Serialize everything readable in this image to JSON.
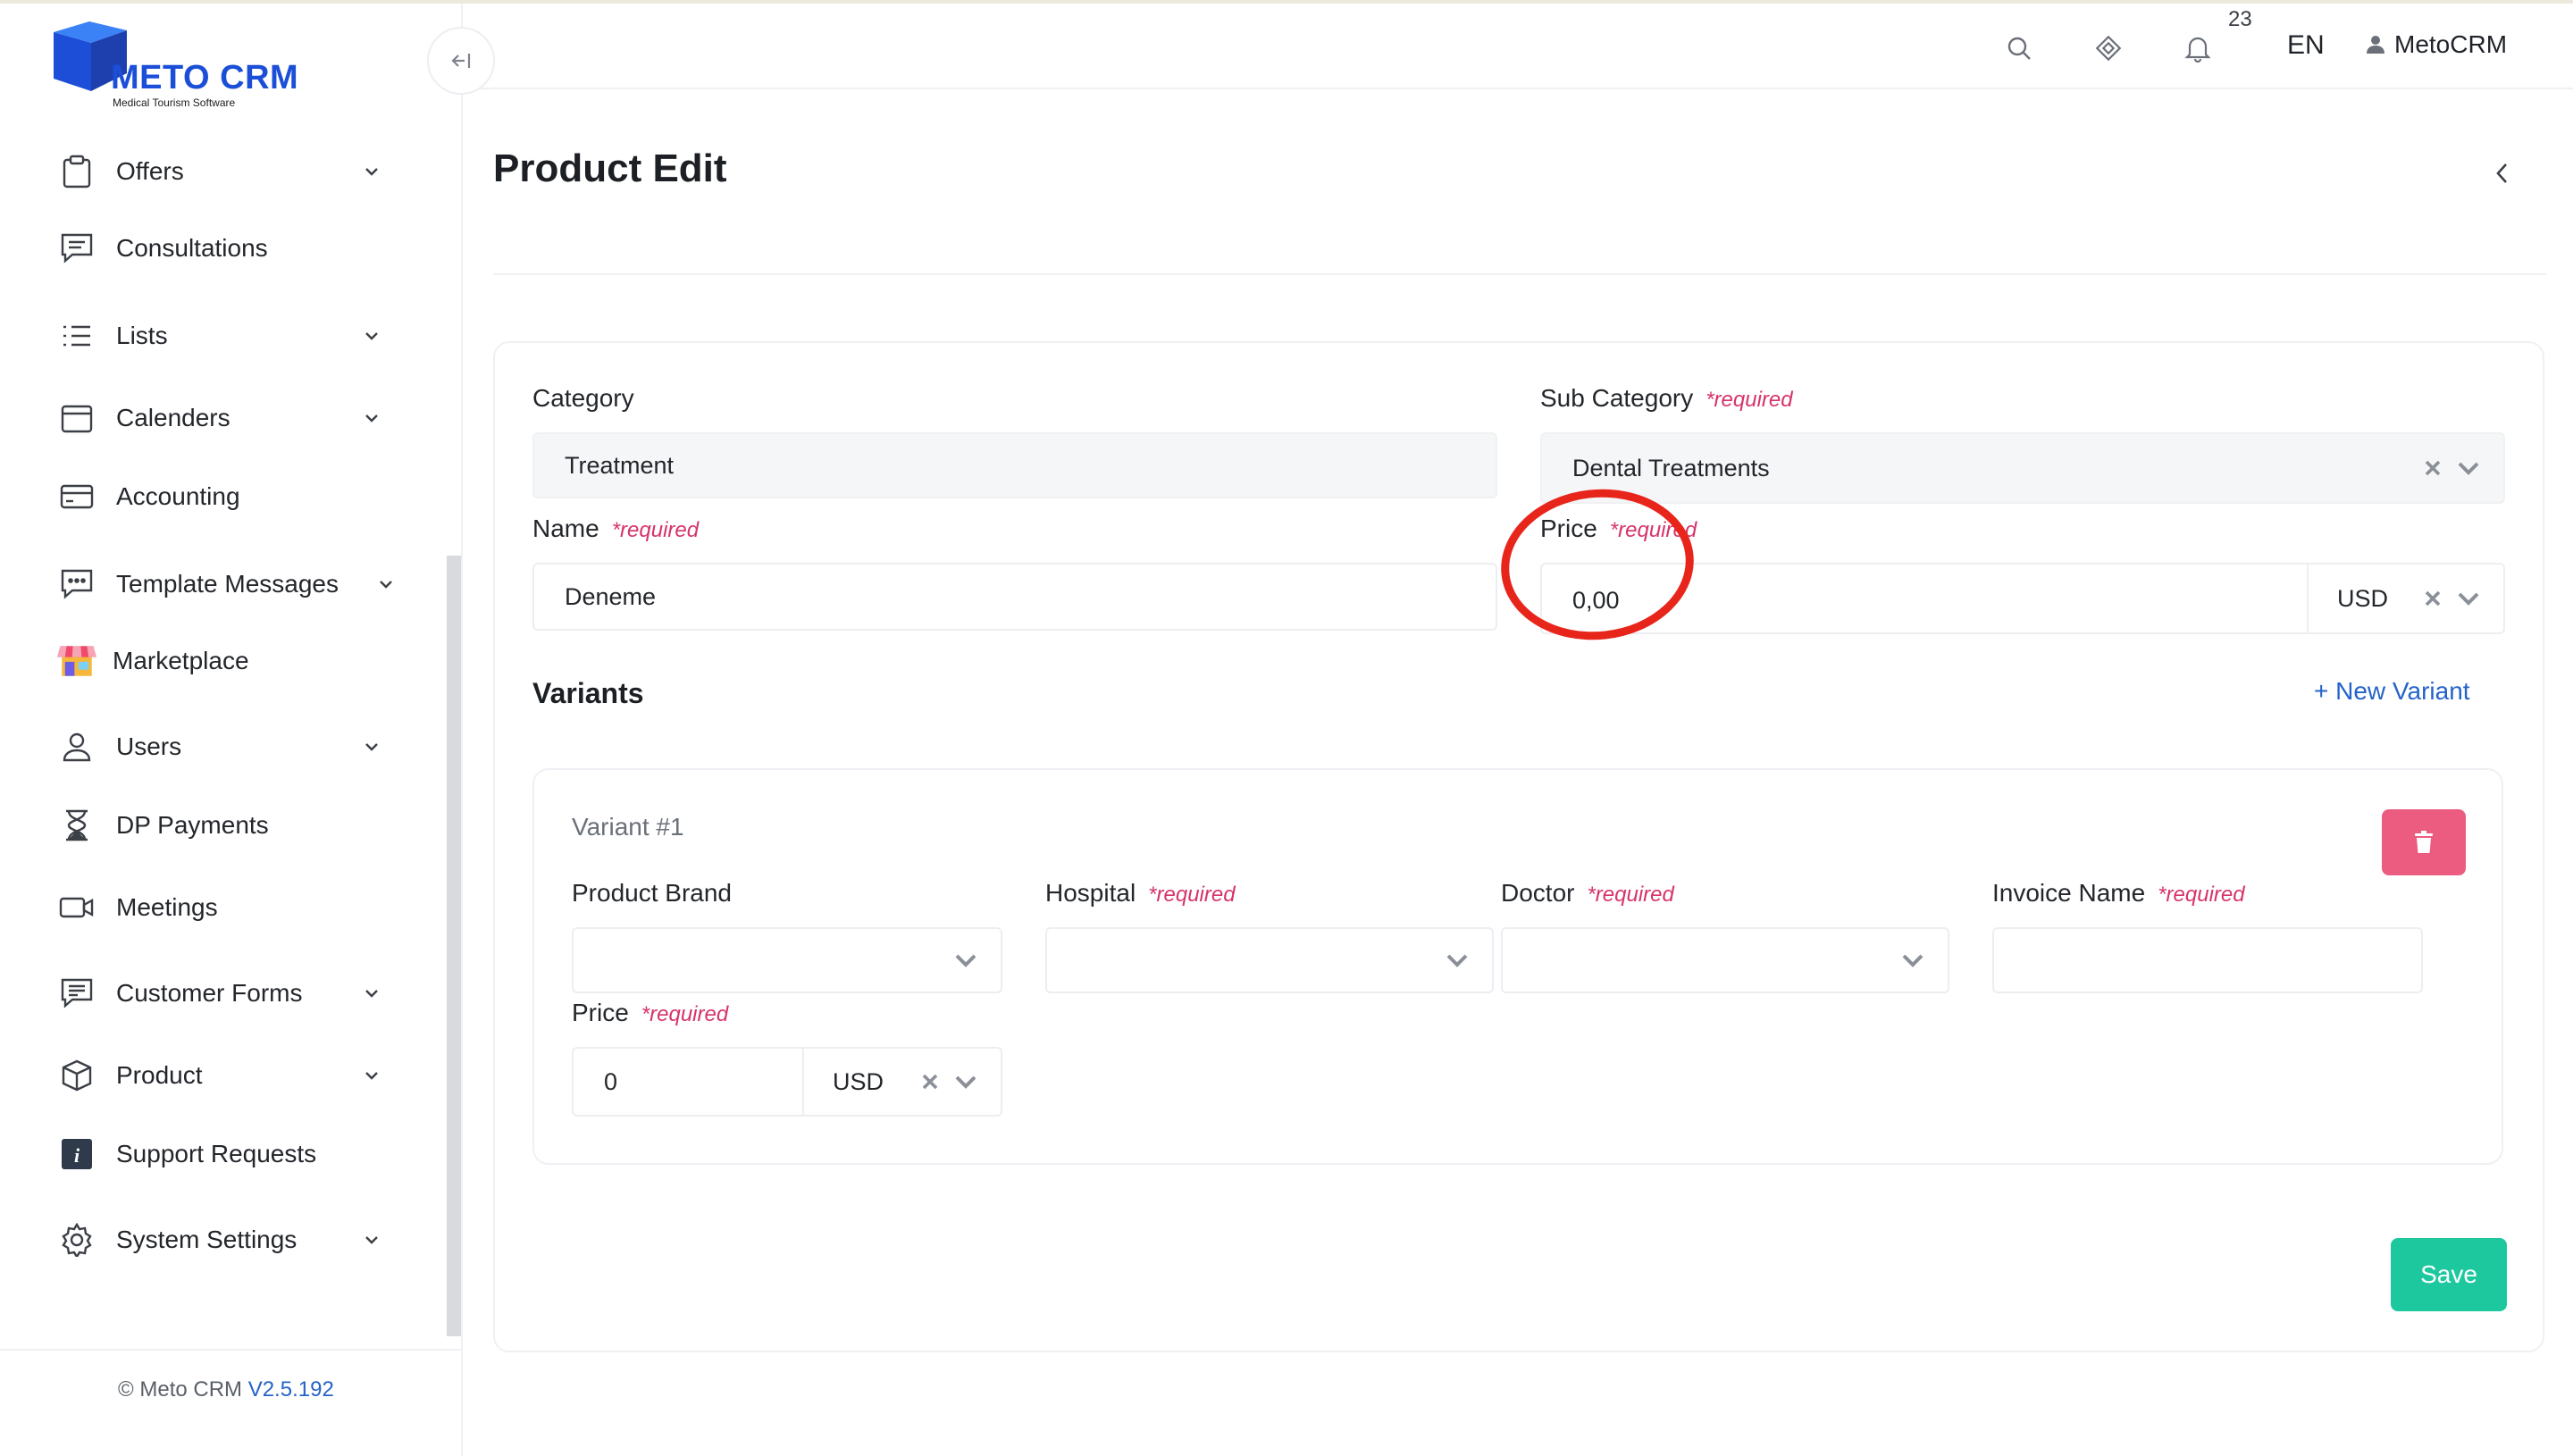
{
  "app": {
    "brand": "METO CRM",
    "tagline": "Medical Tourism Software",
    "footer_copyright": "© Meto CRM",
    "footer_version": "V2.5.192"
  },
  "header": {
    "notification_count": "23",
    "language": "EN",
    "user_name": "MetoCRM"
  },
  "sidebar": {
    "items": [
      {
        "label": "Offers",
        "icon": "clipboard-icon",
        "expandable": true
      },
      {
        "label": "Consultations",
        "icon": "chat-lines-icon",
        "expandable": false
      },
      {
        "label": "Lists",
        "icon": "list-icon",
        "expandable": true
      },
      {
        "label": "Calenders",
        "icon": "calendar-icon",
        "expandable": true
      },
      {
        "label": "Accounting",
        "icon": "credit-card-icon",
        "expandable": false
      },
      {
        "label": "Template Messages",
        "icon": "message-dots-icon",
        "expandable": true
      },
      {
        "label": "Marketplace",
        "icon": "store-icon",
        "expandable": false
      },
      {
        "label": "Users",
        "icon": "user-icon",
        "expandable": true
      },
      {
        "label": "DP Payments",
        "icon": "hourglass-icon",
        "expandable": false
      },
      {
        "label": "Meetings",
        "icon": "video-camera-icon",
        "expandable": false
      },
      {
        "label": "Customer Forms",
        "icon": "form-icon",
        "expandable": true
      },
      {
        "label": "Product",
        "icon": "box-icon",
        "expandable": true
      },
      {
        "label": "Support Requests",
        "icon": "info-icon",
        "expandable": false
      },
      {
        "label": "System Settings",
        "icon": "gear-icon",
        "expandable": true
      }
    ]
  },
  "page": {
    "title": "Product Edit"
  },
  "form": {
    "required_text": "*required",
    "category": {
      "label": "Category",
      "value": "Treatment"
    },
    "sub_category": {
      "label": "Sub Category",
      "value": "Dental Treatments"
    },
    "name": {
      "label": "Name",
      "value": "Deneme"
    },
    "price": {
      "label": "Price",
      "value": "0,00",
      "currency": "USD"
    }
  },
  "variants": {
    "title": "Variants",
    "new_variant_label": "+ New Variant",
    "items": [
      {
        "title": "Variant #1",
        "product_brand": {
          "label": "Product Brand",
          "value": ""
        },
        "hospital": {
          "label": "Hospital",
          "value": ""
        },
        "doctor": {
          "label": "Doctor",
          "value": ""
        },
        "invoice_name": {
          "label": "Invoice Name",
          "value": ""
        },
        "price": {
          "label": "Price",
          "value": "0",
          "currency": "USD"
        }
      }
    ]
  },
  "actions": {
    "save_label": "Save"
  },
  "colors": {
    "brand_blue": "#1c4fd8",
    "link_blue": "#2463c9",
    "required_pink": "#d6336c",
    "delete_pink": "#ec5b80",
    "save_green": "#1ec89f",
    "annotation_red": "#e8251a"
  }
}
